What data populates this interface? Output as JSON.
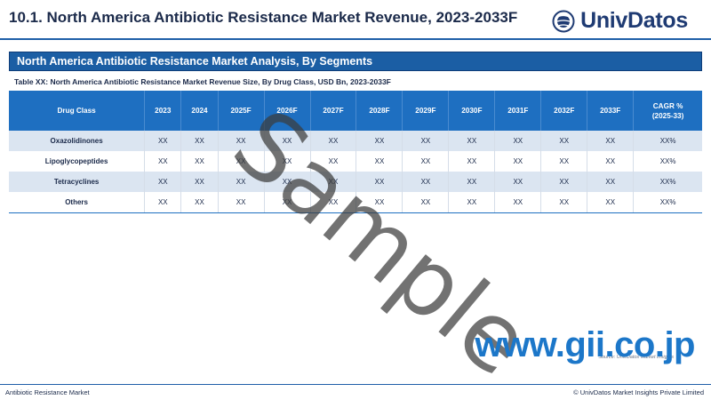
{
  "header": {
    "title": "10.1. North America Antibiotic Resistance Market Revenue, 2023-2033F",
    "logo_text": "UnivDatos",
    "logo_icon": "globe-icon",
    "brand_color": "#1f3b73"
  },
  "section": {
    "title": "North America Antibiotic Resistance Market Analysis, By Segments",
    "bar_color": "#1b5ea4"
  },
  "table": {
    "caption": "Table XX: North America Antibiotic Resistance Market Revenue Size, By Drug Class, USD Bn, 2023-2033F",
    "headers": [
      "Drug Class",
      "2023",
      "2024",
      "2025F",
      "2026F",
      "2027F",
      "2028F",
      "2029F",
      "2030F",
      "2031F",
      "2032F",
      "2033F",
      "CAGR %\n(2025-33)"
    ],
    "rows": [
      [
        "Oxazolidinones",
        "XX",
        "XX",
        "XX",
        "XX",
        "XX",
        "XX",
        "XX",
        "XX",
        "XX",
        "XX",
        "XX",
        "XX%"
      ],
      [
        "Lipoglycopeptides",
        "XX",
        "XX",
        "XX",
        "XX",
        "XX",
        "XX",
        "XX",
        "XX",
        "XX",
        "XX",
        "XX",
        "XX%"
      ],
      [
        "Tetracyclines",
        "XX",
        "XX",
        "XX",
        "XX",
        "XX",
        "XX",
        "XX",
        "XX",
        "XX",
        "XX",
        "XX",
        "XX%"
      ],
      [
        "Others",
        "XX",
        "XX",
        "XX",
        "XX",
        "XX",
        "XX",
        "XX",
        "XX",
        "XX",
        "XX",
        "XX",
        "XX%"
      ]
    ],
    "header_color": "#1e6fc1",
    "shaded_row_color": "#dbe5f1"
  },
  "source": "Source: UnivDatos Market Insights",
  "footer": {
    "left": "Antibiotic Resistance Market",
    "right": "© UnivDatos Market Insights Private Limited"
  },
  "watermarks": {
    "sample": "Sample",
    "url": "www.gii.co.jp"
  }
}
